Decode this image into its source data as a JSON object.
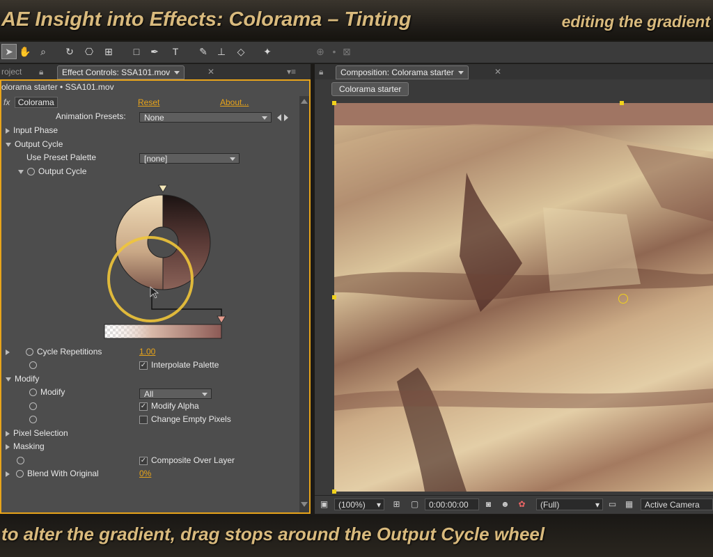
{
  "banner": {
    "title": "AE Insight into Effects: Colorama – Tinting",
    "subtitle": "editing the gradient"
  },
  "caption": "to alter the gradient, drag stops around the Output Cycle wheel",
  "toolbar": {
    "tools": [
      "selection-tool",
      "hand-tool",
      "zoom-tool",
      "rotation-tool",
      "orbit-camera-tool",
      "track-xy-camera-tool",
      "rectangle-tool",
      "pen-tool",
      "type-tool",
      "brush-tool",
      "clone-stamp-tool",
      "eraser-tool",
      "puppet-pin-tool"
    ]
  },
  "left_tabs": {
    "project": "roject",
    "effect_controls": "Effect Controls: SSA101.mov"
  },
  "effect_controls": {
    "breadcrumb": "olorama starter • SSA101.mov",
    "effect_name": "Colorama",
    "reset": "Reset",
    "about": "About...",
    "animation_presets_label": "Animation Presets:",
    "animation_presets_value": "None",
    "input_phase": "Input Phase",
    "output_cycle_group": "Output Cycle",
    "use_preset_palette_label": "Use Preset Palette",
    "use_preset_palette_value": "[none]",
    "output_cycle": "Output Cycle",
    "cycle_repetitions_label": "Cycle Repetitions",
    "cycle_repetitions_value": "1.00",
    "interpolate_palette": "Interpolate Palette",
    "modify_group": "Modify",
    "modify_label": "Modify",
    "modify_value": "All",
    "modify_alpha": "Modify Alpha",
    "change_empty_pixels": "Change Empty Pixels",
    "pixel_selection": "Pixel Selection",
    "masking": "Masking",
    "composite_over_layer": "Composite Over Layer",
    "blend_label": "Blend With Original",
    "blend_value": "0%"
  },
  "composition": {
    "tab": "Composition: Colorama starter",
    "chip": "Colorama starter",
    "zoom": "(100%)",
    "timecode": "0:00:00:00",
    "resolution": "(Full)",
    "camera": "Active Camera"
  },
  "colors": {
    "accent": "#e8a41a",
    "banner_text": "#d9ba7d",
    "handle": "#f1d21c"
  }
}
